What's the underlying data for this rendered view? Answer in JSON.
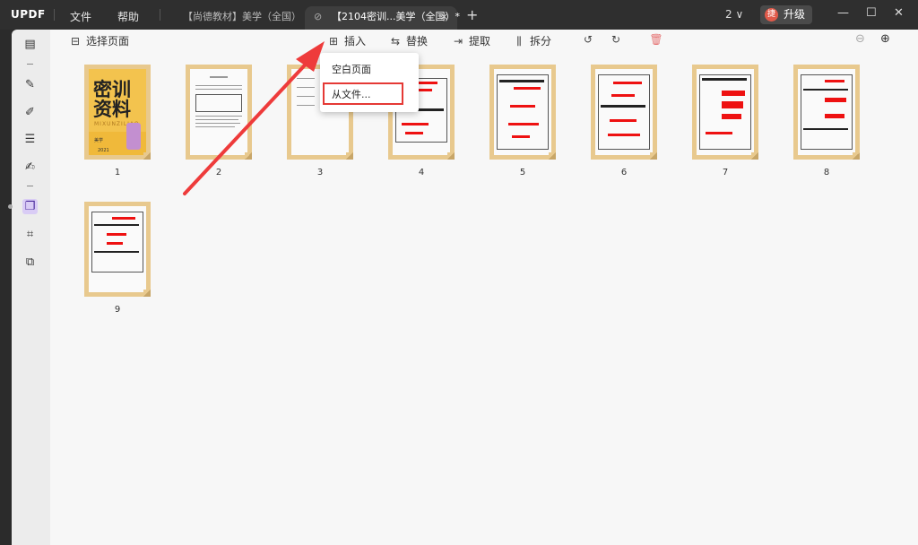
{
  "app": {
    "logo": "UPDF"
  },
  "menu": {
    "file": "文件",
    "help": "帮助"
  },
  "tabs": [
    {
      "label": "【尚德教材】美学（全国）"
    },
    {
      "label": "【2104密训...美学（全国）*",
      "close": "×"
    }
  ],
  "titlebar": {
    "new_tab": "+",
    "page_count": "2",
    "page_count_arrow": "∨",
    "upgrade": "升级",
    "avatar": "捷",
    "minimize": "—",
    "maximize": "☐",
    "close": "✕"
  },
  "toolbar": {
    "select_pages": "选择页面",
    "insert": "插入",
    "replace": "替换",
    "extract": "提取",
    "split": "拆分"
  },
  "dropdown": {
    "blank_page": "空白页面",
    "from_file": "从文件..."
  },
  "cover": {
    "line1": "密训",
    "line2": "资料",
    "sub": "MIXUNZILIAO",
    "small": "美学",
    "year": "2021"
  },
  "pages": [
    {
      "number": "1"
    },
    {
      "number": "2"
    },
    {
      "number": "3"
    },
    {
      "number": "4"
    },
    {
      "number": "5"
    },
    {
      "number": "6"
    },
    {
      "number": "7"
    },
    {
      "number": "8"
    },
    {
      "number": "9"
    }
  ],
  "colors": {
    "accent": "#7b4fd6",
    "highlight_box": "#e53935",
    "thumb_border": "#e8c98e",
    "cover": "#f3c34e"
  }
}
